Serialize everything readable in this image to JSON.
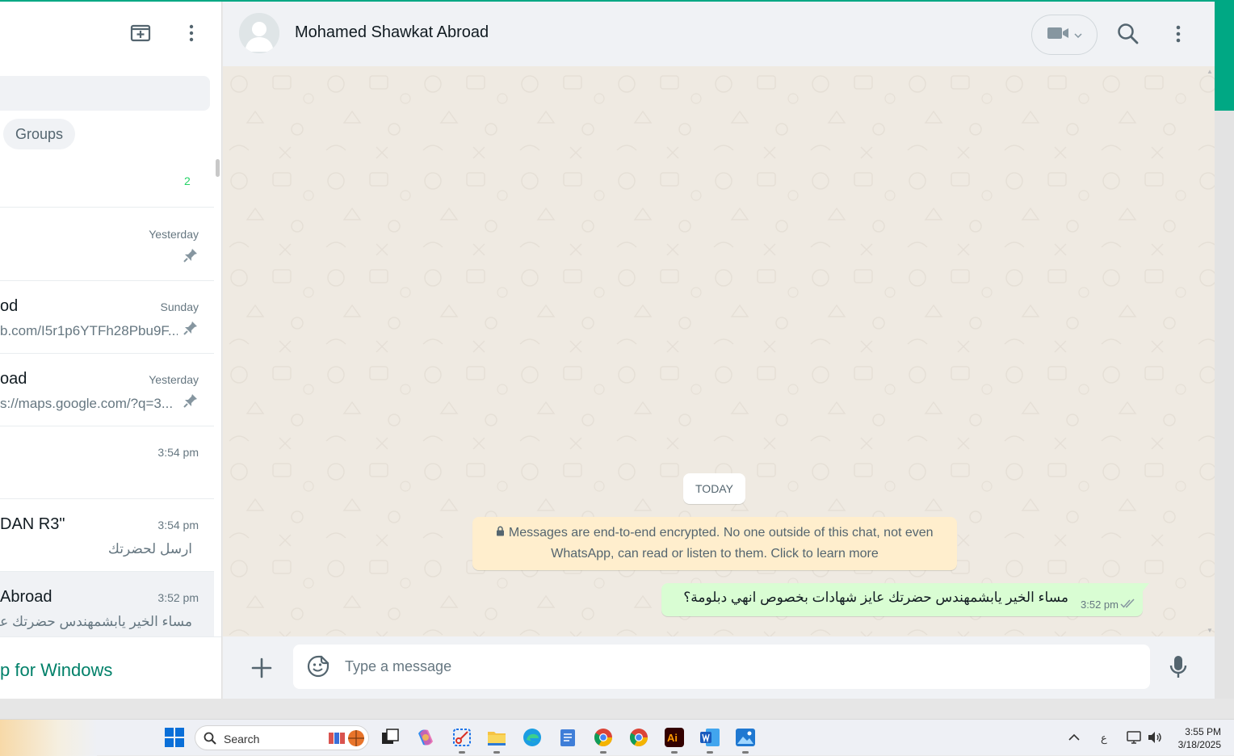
{
  "left_pane": {
    "filter_chip": "Groups",
    "archived_count": "2",
    "chats": [
      {
        "name": "",
        "time": "Yesterday",
        "preview": "",
        "pinned": true
      },
      {
        "name": "od",
        "time": "Sunday",
        "preview": "b.com/I5r1p6YTFh28Pbu9F...",
        "pinned": true
      },
      {
        "name": "oad",
        "time": "Yesterday",
        "preview": "s://maps.google.com/?q=3...",
        "pinned": true
      },
      {
        "name": "",
        "time": "3:54 pm",
        "preview": "",
        "pinned": false
      },
      {
        "name": "DAN R3\"",
        "time": "3:54 pm",
        "preview": "ارسل لحضرتك",
        "pinned": false
      },
      {
        "name": "Abroad",
        "time": "3:52 pm",
        "preview": "مساء الخير يابشمهندس حضرتك عا",
        "pinned": false,
        "active": true
      }
    ],
    "get_app_label": "p for Windows"
  },
  "header": {
    "contact_name": "Mohamed Shawkat Abroad"
  },
  "conversation": {
    "date_chip": "TODAY",
    "encryption_notice_line1": "Messages are end-to-end encrypted. No one outside of this chat, not even",
    "encryption_notice_line2": "WhatsApp, can read or listen to them. Click to learn more",
    "messages": [
      {
        "direction": "outgoing",
        "text": "مساء الخير يابشمهندس حضرتك عايز شهادات بخصوص انهي دبلومة؟",
        "time": "3:52 pm",
        "status": "delivered"
      }
    ]
  },
  "composer": {
    "placeholder": "Type a message"
  },
  "taskbar": {
    "search_label": "Search",
    "language": "ع",
    "time": "3:55 PM",
    "date": "3/18/2025"
  },
  "icons": {
    "new_chat": "new-chat-icon",
    "menu": "menu-icon",
    "pin": "pin-icon",
    "video": "video-call-icon",
    "search": "search-icon",
    "attach": "plus-icon",
    "emoji": "sticker-icon",
    "mic": "microphone-icon"
  },
  "colors": {
    "accent": "#00a884",
    "outgoing_bubble": "#d9fdd3",
    "notice_bg": "#ffeecd",
    "chat_bg": "#efeae2",
    "unread": "#25d366"
  }
}
